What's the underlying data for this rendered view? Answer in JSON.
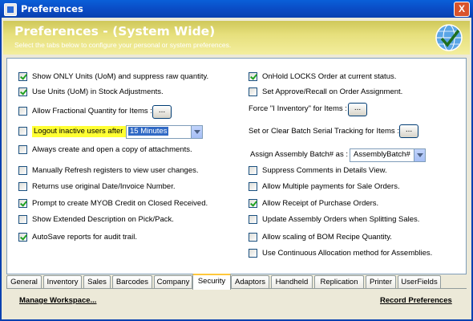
{
  "window": {
    "title": "Preferences",
    "close_label": "X"
  },
  "banner": {
    "title": "Preferences - (System Wide)",
    "subtitle": "Select the tabs below to configure your personal or system preferences."
  },
  "left_options": [
    {
      "label": "Show ONLY Units (UoM) and suppress raw quantity.",
      "checked": true
    },
    {
      "label": "Use Units (UoM) in Stock Adjustments.",
      "checked": true
    },
    {
      "label": "Allow Fractional Quantity for Items :",
      "checked": false
    },
    {
      "label": "Logout inactive users after :",
      "checked": false
    },
    {
      "label": "Always create and open a copy of attachments.",
      "checked": false
    },
    {
      "label": "Manually Refresh registers to view user changes.",
      "checked": false
    },
    {
      "label": "Returns use original Date/Invoice Number.",
      "checked": false
    },
    {
      "label": "Prompt to create MYOB Credit on Closed Received.",
      "checked": true
    },
    {
      "label": "Show Extended Description on Pick/Pack.",
      "checked": false
    },
    {
      "label": "AutoSave reports for audit trail.",
      "checked": true
    }
  ],
  "logout_select": {
    "value": "15 Minutes"
  },
  "ellipsis_label": "...",
  "right_options": {
    "onhold": {
      "label": "OnHold LOCKS Order at current status.",
      "checked": true
    },
    "approve": {
      "label": "Set Approve/Recall on Order Assignment.",
      "checked": false
    },
    "force_inventory": {
      "label": "Force \"I Inventory\" for Items :"
    },
    "batch_serial": {
      "label": "Set or Clear Batch Serial Tracking for Items :"
    },
    "assembly_batch": {
      "label": "Assign Assembly Batch# as :",
      "value": "AssemblyBatch#"
    },
    "checks": [
      {
        "label": "Suppress Comments in Details View.",
        "checked": false
      },
      {
        "label": "Allow Multiple payments for Sale Orders.",
        "checked": false
      },
      {
        "label": "Allow Receipt of Purchase Orders.",
        "checked": true
      },
      {
        "label": "Update Assembly Orders when Splitting Sales.",
        "checked": false
      },
      {
        "label": "Allow scaling of BOM Recipe Quantity.",
        "checked": false
      },
      {
        "label": "Use Continuous Allocation method for Assemblies.",
        "checked": false
      }
    ]
  },
  "tabs": [
    "General",
    "Inventory",
    "Sales",
    "Barcodes",
    "Company",
    "Security",
    "Adaptors",
    "Handheld",
    "Replication",
    "Printer",
    "UserFields"
  ],
  "active_tab": "Security",
  "footer": {
    "manage": "Manage Workspace...",
    "record": "Record Preferences"
  },
  "colors": {
    "titlebar": "#0a5fd8",
    "banner": "#e6df7c",
    "highlight": "#ffff33",
    "selection": "#316ac5"
  }
}
